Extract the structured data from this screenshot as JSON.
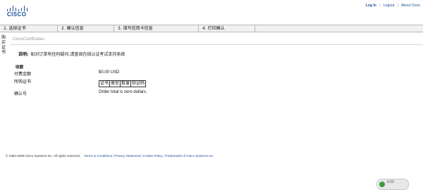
{
  "brand": {
    "logo_text": "CISCO",
    "brand_color": "#1a4e94"
  },
  "top_links": {
    "login": "Log In",
    "logout": "Logout",
    "about": "About Cisco",
    "separator": "|"
  },
  "steps": [
    {
      "label": "1. 选择证书"
    },
    {
      "label": "2. 确认信息"
    },
    {
      "label": "3. 填写信用卡信息"
    },
    {
      "label": "4. 打印确认"
    }
  ],
  "side_label": "购买证书",
  "page": {
    "section_title": "CiscoCertificates",
    "note_label": "说明:",
    "note_text": "如对订单有任何疑问,请查阅在线认证考试支持系统"
  },
  "receipt": {
    "heading": "收据",
    "amount_label": "付费金额",
    "amount_value": "$0.00 USD",
    "certs_label": "所购证书",
    "cert_columns": [
      "证书",
      "类型",
      "数量",
      "验证码"
    ],
    "confirm_label": "确认号",
    "confirm_value": "Order total is zero dollars."
  },
  "footer": {
    "copyright": "© 1992-2006 Cisco Systems Inc. All rights reserved.",
    "links": [
      "Terms & Conditions",
      "Privacy Statement",
      "Cookie Policy",
      "Trademarks of Cisco Systems Inc."
    ],
    "separator": "|"
  },
  "chat_widget": {
    "icon": "chat-bubble-icon",
    "text": "0:29"
  }
}
